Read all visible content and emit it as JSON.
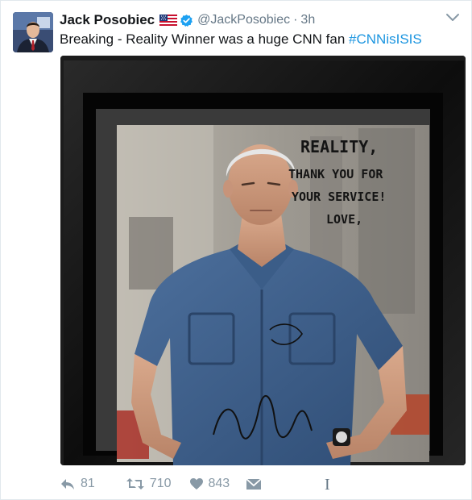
{
  "tweet": {
    "author_name": "Jack Posobiec",
    "handle": "@JackPosobiec",
    "separator": "·",
    "time": "3h",
    "text_prefix": "Breaking - Reality Winner was a huge CNN fan ",
    "hashtag": "#CNNisISIS",
    "photo_inscription": {
      "line1": "REALITY,",
      "line2": "THANK YOU FOR",
      "line3": "YOUR SERVICE!",
      "line4": "LOVE,"
    }
  },
  "actions": {
    "reply_count": "81",
    "retweet_count": "710",
    "like_count": "843"
  },
  "colors": {
    "link": "#1b95e0",
    "verified": "#1da1f2",
    "muted": "#8899a6"
  },
  "icons": {
    "reply": "reply-icon",
    "retweet": "retweet-icon",
    "like": "heart-icon",
    "dm": "envelope-icon",
    "verified": "verified-badge-icon",
    "flag": "us-flag-icon",
    "caret": "chevron-down-icon"
  }
}
